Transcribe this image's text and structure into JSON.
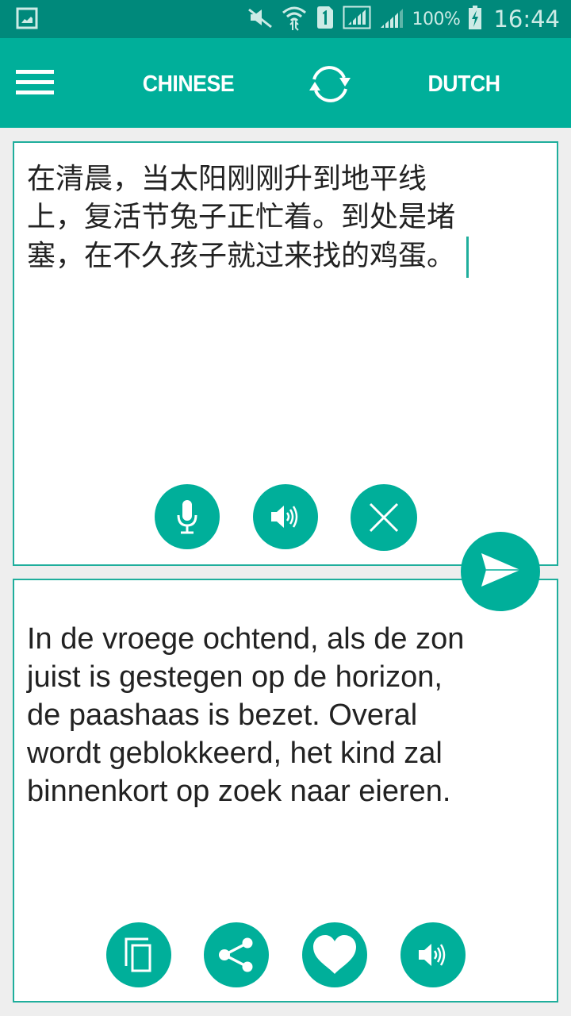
{
  "status_bar": {
    "left_icon": "gallery-notification-icon",
    "icons": [
      "mute-icon",
      "wifi-icon",
      "sim-1-icon",
      "signal-icon",
      "signal-icon"
    ],
    "battery_percent": "100%",
    "battery_state": "charging",
    "time": "16:44"
  },
  "app_bar": {
    "menu_icon": "hamburger-menu-icon",
    "source_language": "CHINESE",
    "swap_icon": "swap-languages-icon",
    "target_language": "DUTCH"
  },
  "source_panel": {
    "text": "在清晨，当太阳刚刚升到地平线上，复活节兔子正忙着。到处是堵塞，在不久孩子就过来找的鸡蛋。",
    "lines": [
      "在清晨，当太阳刚刚升到地平线",
      "上，复活节兔子正忙着。到处是堵",
      "塞，在不久孩子就过来找的鸡蛋。"
    ],
    "actions": [
      {
        "name": "microphone",
        "icon": "microphone-icon"
      },
      {
        "name": "speak",
        "icon": "speaker-icon"
      },
      {
        "name": "clear",
        "icon": "close-icon"
      }
    ]
  },
  "send_button": {
    "icon": "send-icon"
  },
  "target_panel": {
    "text": "In de vroege ochtend, als de zon juist is gestegen op de horizon, de paashaas is bezet. Overal wordt geblokkeerd, het kind zal binnenkort op zoek naar eieren.",
    "lines": [
      "In de vroege ochtend, als de zon",
      "juist is gestegen op de horizon,",
      "de paashaas is bezet. Overal",
      "wordt geblokkeerd, het kind zal",
      "binnenkort op zoek naar eieren."
    ],
    "actions": [
      {
        "name": "copy",
        "icon": "copy-icon"
      },
      {
        "name": "share",
        "icon": "share-icon"
      },
      {
        "name": "favorite",
        "icon": "heart-icon"
      },
      {
        "name": "speak",
        "icon": "speaker-icon"
      }
    ]
  },
  "colors": {
    "status_bar": "#00897B",
    "primary": "#00AF9A",
    "panel_border": "#1FAE9C",
    "background": "#EEEEEE"
  }
}
